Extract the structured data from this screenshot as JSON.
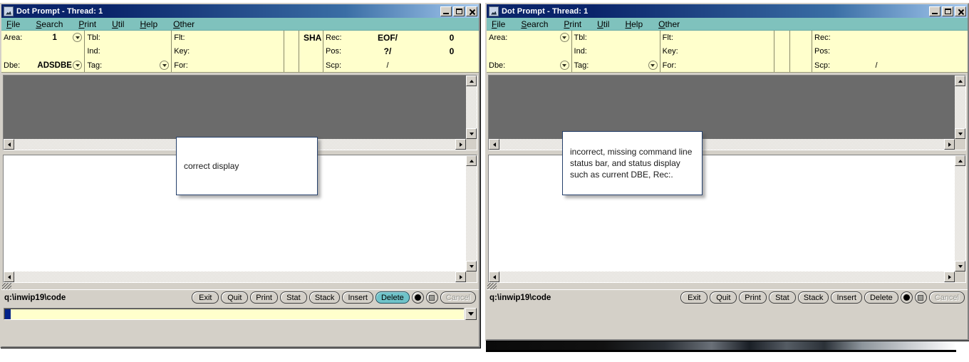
{
  "windows": [
    {
      "id": "left",
      "title": "Dot Prompt - Thread: 1",
      "menu": [
        "File",
        "Search",
        "Print",
        "Util",
        "Help",
        "Other"
      ],
      "info": {
        "area_label": "Area:",
        "area_value": "1",
        "dbe_label": "Dbe:",
        "dbe_value": "ADSDBE",
        "tbl_label": "Tbl:",
        "tbl_value": "",
        "ind_label": "Ind:",
        "ind_value": "",
        "tag_label": "Tag:",
        "tag_value": "",
        "flt_label": "Flt:",
        "flt_value": "",
        "key_label": "Key:",
        "key_value": "",
        "for_label": "For:",
        "for_value": "",
        "sha": "SHA",
        "rec_label": "Rec:",
        "rec_value": "EOF/",
        "rec_count": "0",
        "pos_label": "Pos:",
        "pos_value": "?/",
        "pos_count": "0",
        "scp_label": "Scp:",
        "scp_value": "/"
      },
      "status_path": "q:\\inwip19\\code",
      "buttons": [
        "Exit",
        "Quit",
        "Print",
        "Stat",
        "Stack",
        "Insert",
        "Delete"
      ],
      "selected_button": "Delete",
      "cancel_label": "Cancel",
      "record_icon": "record-dot-icon",
      "stop_icon": "stop-square-icon",
      "command_line": {
        "value": "",
        "placeholder": "",
        "has_caret": true,
        "dropdown_icon": "chevron-down-icon"
      },
      "has_command_line": true
    },
    {
      "id": "right",
      "title": "Dot Prompt - Thread: 1",
      "menu": [
        "File",
        "Search",
        "Print",
        "Util",
        "Help",
        "Other"
      ],
      "info": {
        "area_label": "Area:",
        "area_value": "",
        "dbe_label": "Dbe:",
        "dbe_value": "",
        "tbl_label": "Tbl:",
        "tbl_value": "",
        "ind_label": "Ind:",
        "ind_value": "",
        "tag_label": "Tag:",
        "tag_value": "",
        "flt_label": "Flt:",
        "flt_value": "",
        "key_label": "Key:",
        "key_value": "",
        "for_label": "For:",
        "for_value": "",
        "sha": "",
        "rec_label": "Rec:",
        "rec_value": "",
        "rec_count": "",
        "pos_label": "Pos:",
        "pos_value": "",
        "pos_count": "",
        "scp_label": "Scp:",
        "scp_value": "/"
      },
      "status_path": "q:\\inwip19\\code",
      "buttons": [
        "Exit",
        "Quit",
        "Print",
        "Stat",
        "Stack",
        "Insert",
        "Delete"
      ],
      "selected_button": "",
      "cancel_label": "Cancel",
      "record_icon": "record-dot-icon",
      "stop_icon": "stop-square-icon",
      "command_line": {
        "value": "",
        "placeholder": "",
        "has_caret": false,
        "dropdown_icon": "chevron-down-icon"
      },
      "has_command_line": false
    }
  ],
  "callouts": {
    "left": "correct display",
    "right": "incorrect, missing command line status bar, and status display such as current DBE, Rec:."
  },
  "colors": {
    "titlebar_start": "#0a246a",
    "titlebar_end": "#a6caf0",
    "menubar": "#7fc2bd",
    "info_panel": "#ffffcc",
    "output_pane": "#6b6b6b",
    "editor_pane": "#ffffff",
    "window_face": "#d4d0c8",
    "selected_button": "#6fc3c9",
    "caret": "#00218a",
    "callout_border": "#25406b"
  },
  "window_controls": {
    "minimize": "minimize-icon",
    "maximize": "maximize-icon",
    "close": "close-icon"
  }
}
